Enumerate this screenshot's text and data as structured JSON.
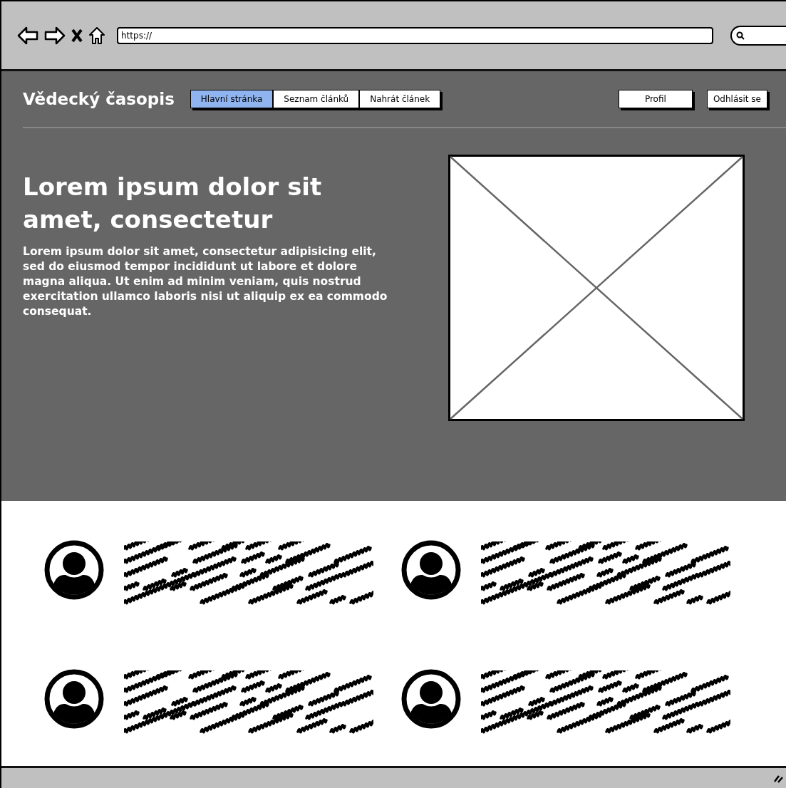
{
  "browser": {
    "url": "https://"
  },
  "header": {
    "title": "Vědecký časopis",
    "tabs": [
      {
        "label": "Hlavní stránka",
        "selected": true
      },
      {
        "label": "Seznam článků",
        "selected": false
      },
      {
        "label": "Nahrát článek",
        "selected": false
      }
    ],
    "buttons": [
      "Profil",
      "Odhlásit se"
    ]
  },
  "hero": {
    "heading": "Lorem ipsum dolor sit amet, consectetur",
    "text": "Lorem ipsum dolor sit amet, consectetur adipisicing elit, sed do eiusmod tempor incididunt ut labore et dolore magna aliqua. Ut enim ad minim veniam, quis nostrud exercitation ullamco laboris nisi ut aliquip ex ea commodo consequat.",
    "image": {
      "kind": "image-placeholder"
    }
  },
  "profiles": [
    {
      "kind": "avatar"
    },
    {
      "kind": "avatar"
    },
    {
      "kind": "avatar"
    },
    {
      "kind": "avatar"
    }
  ]
}
